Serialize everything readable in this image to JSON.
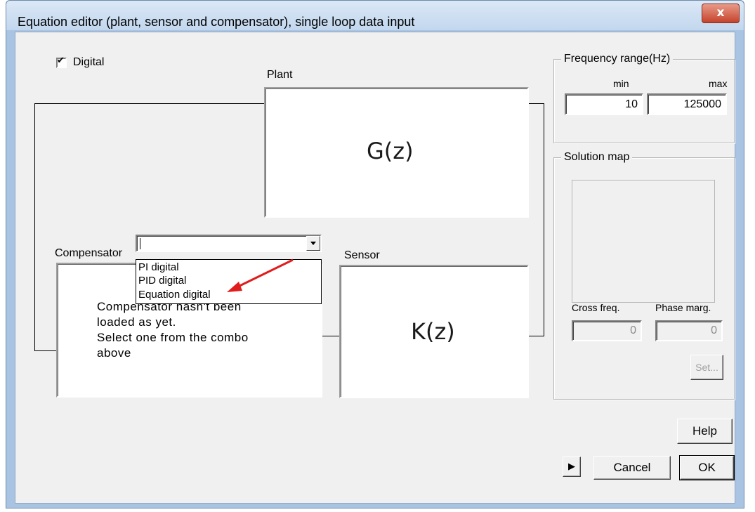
{
  "window": {
    "title": "Equation editor (plant, sensor and compensator), single loop data input",
    "close_label": "x"
  },
  "digital_checkbox": {
    "label": "Digital",
    "checked": true,
    "check_glyph": "✔"
  },
  "plant": {
    "label": "Plant",
    "function": "G(z)"
  },
  "sensor": {
    "label": "Sensor",
    "function": "K(z)"
  },
  "compensator": {
    "label": "Compensator",
    "combo_value": "",
    "options": [
      "PI digital",
      "PID digital",
      "Equation digital"
    ],
    "message_lines": [
      "Compensator hasn't been",
      "loaded as yet.",
      "Select one from the combo",
      "above"
    ]
  },
  "frequency_range": {
    "legend": "Frequency range(Hz)",
    "min_label": "min",
    "max_label": "max",
    "min_value": "10",
    "max_value": "125000"
  },
  "solution_map": {
    "legend": "Solution map",
    "cross_freq_label": "Cross freq.",
    "phase_marg_label": "Phase marg.",
    "cross_freq_value": "0",
    "phase_marg_value": "0",
    "set_label": "Set..."
  },
  "buttons": {
    "help": "Help",
    "cancel": "Cancel",
    "ok": "OK",
    "expand_glyph": "▶"
  },
  "colors": {
    "annotation_arrow": "#e01c1c",
    "title_bar": "#c2d7ee",
    "close_button": "#c5432c",
    "dialog_face": "#f0f0f0"
  }
}
